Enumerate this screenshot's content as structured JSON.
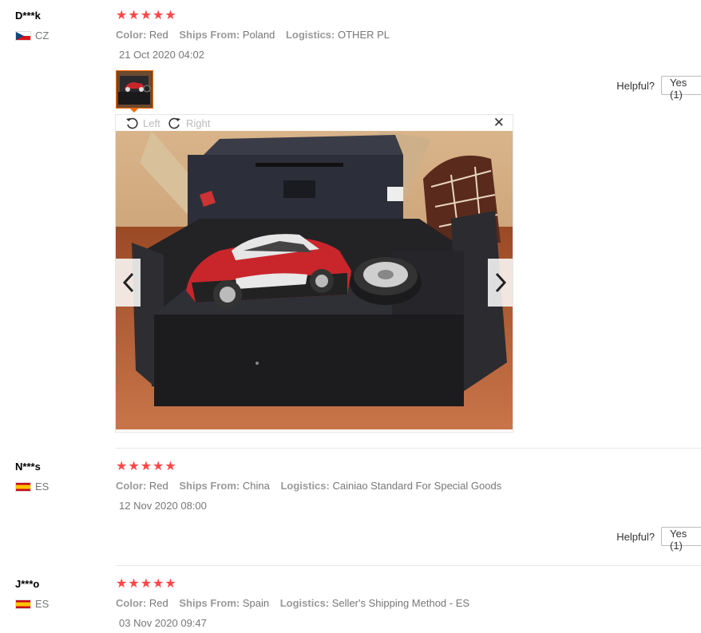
{
  "reviews": [
    {
      "user": "D***k",
      "country_code": "CZ",
      "flag": "czech-flag",
      "stars": 5,
      "meta": [
        {
          "key": "Color:",
          "value": "Red"
        },
        {
          "key": "Ships From:",
          "value": "Poland"
        },
        {
          "key": "Logistics:",
          "value": "OTHER PL"
        }
      ],
      "date": "21 Oct 2020 04:02",
      "helpful_label": "Helpful?",
      "yes_label": "Yes (1)"
    },
    {
      "user": "N***s",
      "country_code": "ES",
      "flag": "spain-flag",
      "stars": 5,
      "meta": [
        {
          "key": "Color:",
          "value": "Red"
        },
        {
          "key": "Ships From:",
          "value": "China"
        },
        {
          "key": "Logistics:",
          "value": "Cainiao Standard For Special Goods"
        }
      ],
      "date": "12 Nov 2020 08:00",
      "helpful_label": "Helpful?",
      "yes_label": "Yes (1)"
    },
    {
      "user": "J***o",
      "country_code": "ES",
      "flag": "spain-flag",
      "stars": 5,
      "meta": [
        {
          "key": "Color:",
          "value": "Red"
        },
        {
          "key": "Ships From:",
          "value": "Spain"
        },
        {
          "key": "Logistics:",
          "value": "Seller's Shipping Method - ES"
        }
      ],
      "date": "03 Nov 2020 09:47"
    }
  ],
  "viewer": {
    "rotate_left_label": "Left",
    "rotate_right_label": "Right",
    "close_icon": "close-icon",
    "prev_icon": "chevron-left-icon",
    "next_icon": "chevron-right-icon"
  },
  "colors": {
    "star": "#ff4747",
    "thumb_border": "#ff6600"
  },
  "star_glyph": "★"
}
